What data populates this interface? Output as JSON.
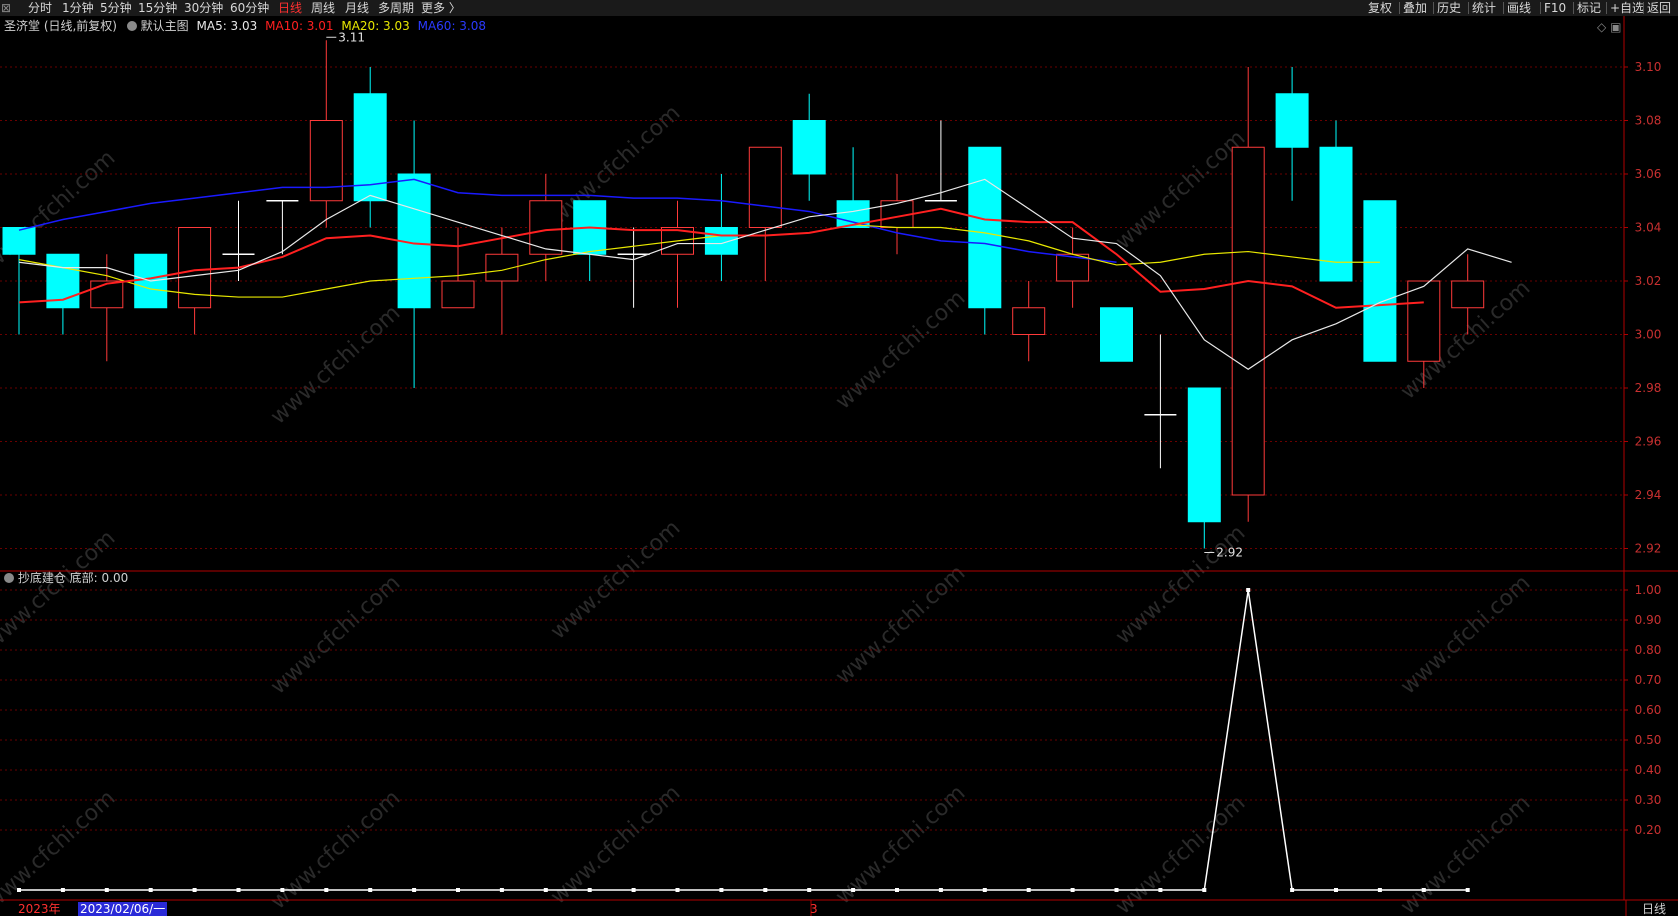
{
  "toolbar": {
    "left": [
      "分时",
      "1分钟",
      "5分钟",
      "15分钟",
      "30分钟",
      "60分钟",
      "日线",
      "周线",
      "月线",
      "多周期",
      "更多 〉"
    ],
    "active": "日线",
    "right": [
      "复权",
      "叠加",
      "历史",
      "统计",
      "画线",
      "F10",
      "标记",
      "+自选",
      "返回"
    ]
  },
  "legend": {
    "stock": "圣济堂 (日线,前复权)",
    "template": "默认主图",
    "ma5": "MA5: 3.03",
    "ma10": "MA10: 3.01",
    "ma20": "MA20: 3.03",
    "ma60": "MA60: 3.08"
  },
  "sub_legend": {
    "name": "抄底建仓",
    "value": "底部: 0.00"
  },
  "annotations": {
    "high": "3.11",
    "low": "2.92"
  },
  "watermark": "www.cfchi.com",
  "bottom": {
    "year": "2023年",
    "date": "2023/02/06/一",
    "month": "3",
    "period": "日线"
  },
  "colors": {
    "up": "#ff3a3a",
    "down": "#00ffff",
    "ma5": "#e8e8e8",
    "ma10": "#ff2020",
    "ma20": "#e8e800",
    "ma60": "#1a1aff"
  },
  "chart_data": [
    {
      "type": "candlestick",
      "ylim": [
        2.91,
        3.11
      ],
      "yticks": [
        "3.10",
        "3.08",
        "3.06",
        "3.04",
        "3.02",
        "3.00",
        "2.98",
        "2.96",
        "2.94",
        "2.92"
      ],
      "ohlc": [
        [
          3.04,
          3.04,
          3.0,
          3.03
        ],
        [
          3.03,
          3.03,
          3.0,
          3.01
        ],
        [
          3.01,
          3.03,
          2.99,
          3.02
        ],
        [
          3.03,
          3.03,
          3.01,
          3.01
        ],
        [
          3.01,
          3.04,
          3.0,
          3.04
        ],
        [
          3.03,
          3.05,
          3.02,
          3.03
        ],
        [
          3.05,
          3.05,
          3.03,
          3.05
        ],
        [
          3.05,
          3.11,
          3.04,
          3.08
        ],
        [
          3.09,
          3.1,
          3.04,
          3.05
        ],
        [
          3.06,
          3.08,
          2.98,
          3.01
        ],
        [
          3.01,
          3.04,
          3.01,
          3.02
        ],
        [
          3.02,
          3.04,
          3.0,
          3.03
        ],
        [
          3.03,
          3.06,
          3.02,
          3.05
        ],
        [
          3.05,
          3.05,
          3.02,
          3.03
        ],
        [
          3.03,
          3.04,
          3.01,
          3.03
        ],
        [
          3.03,
          3.05,
          3.01,
          3.04
        ],
        [
          3.04,
          3.06,
          3.02,
          3.03
        ],
        [
          3.04,
          3.07,
          3.02,
          3.07
        ],
        [
          3.08,
          3.09,
          3.05,
          3.06
        ],
        [
          3.05,
          3.07,
          3.04,
          3.04
        ],
        [
          3.04,
          3.06,
          3.03,
          3.05
        ],
        [
          3.05,
          3.08,
          3.05,
          3.05
        ],
        [
          3.07,
          3.07,
          3.0,
          3.01
        ],
        [
          3.0,
          3.02,
          2.99,
          3.01
        ],
        [
          3.02,
          3.04,
          3.01,
          3.03
        ],
        [
          3.01,
          3.01,
          2.99,
          2.99
        ],
        [
          2.97,
          3.0,
          2.95,
          2.97
        ],
        [
          2.98,
          2.98,
          2.92,
          2.93
        ],
        [
          2.94,
          3.1,
          2.93,
          3.07
        ],
        [
          3.09,
          3.1,
          3.05,
          3.07
        ],
        [
          3.07,
          3.08,
          3.02,
          3.02
        ],
        [
          3.05,
          3.05,
          2.99,
          2.99
        ],
        [
          2.99,
          3.02,
          2.98,
          3.02
        ],
        [
          3.01,
          3.03,
          3.0,
          3.02
        ]
      ],
      "ma5": [
        3.027,
        3.025,
        3.025,
        3.02,
        3.022,
        3.024,
        3.031,
        3.043,
        3.052,
        3.047,
        3.042,
        3.037,
        3.032,
        3.03,
        3.028,
        3.034,
        3.034,
        3.039,
        3.044,
        3.046,
        3.049,
        3.053,
        3.058,
        3.047,
        3.036,
        3.034,
        3.022,
        2.998,
        2.987,
        2.998,
        3.004,
        3.012,
        3.018,
        3.032,
        3.027
      ],
      "ma10": [
        3.012,
        3.013,
        3.019,
        3.021,
        3.024,
        3.025,
        3.029,
        3.036,
        3.037,
        3.034,
        3.033,
        3.036,
        3.039,
        3.04,
        3.039,
        3.039,
        3.037,
        3.037,
        3.038,
        3.041,
        3.044,
        3.047,
        3.043,
        3.042,
        3.042,
        3.03,
        3.016,
        3.017,
        3.02,
        3.018,
        3.01,
        3.011,
        3.012
      ],
      "ma20": [
        3.028,
        3.025,
        3.022,
        3.017,
        3.015,
        3.014,
        3.014,
        3.017,
        3.02,
        3.021,
        3.022,
        3.024,
        3.028,
        3.031,
        3.033,
        3.035,
        3.037,
        3.037,
        3.038,
        3.041,
        3.04,
        3.04,
        3.038,
        3.035,
        3.03,
        3.026,
        3.027,
        3.03,
        3.031,
        3.029,
        3.027,
        3.027
      ],
      "ma60": [
        3.039,
        3.043,
        3.046,
        3.049,
        3.051,
        3.053,
        3.055,
        3.055,
        3.056,
        3.058,
        3.053,
        3.052,
        3.052,
        3.052,
        3.051,
        3.051,
        3.05,
        3.048,
        3.046,
        3.042,
        3.038,
        3.035,
        3.034,
        3.031,
        3.029,
        3.027
      ]
    },
    {
      "type": "line",
      "series_name": "底部",
      "ylim": [
        0,
        1.0
      ],
      "yticks": [
        "1.00",
        "0.90",
        "0.80",
        "0.70",
        "0.60",
        "0.50",
        "0.40",
        "0.30",
        "0.20"
      ],
      "values": [
        0,
        0,
        0,
        0,
        0,
        0,
        0,
        0,
        0,
        0,
        0,
        0,
        0,
        0,
        0,
        0,
        0,
        0,
        0,
        0,
        0,
        0,
        0,
        0,
        0,
        0,
        0,
        0,
        1,
        0,
        0,
        0,
        0,
        0
      ]
    }
  ]
}
